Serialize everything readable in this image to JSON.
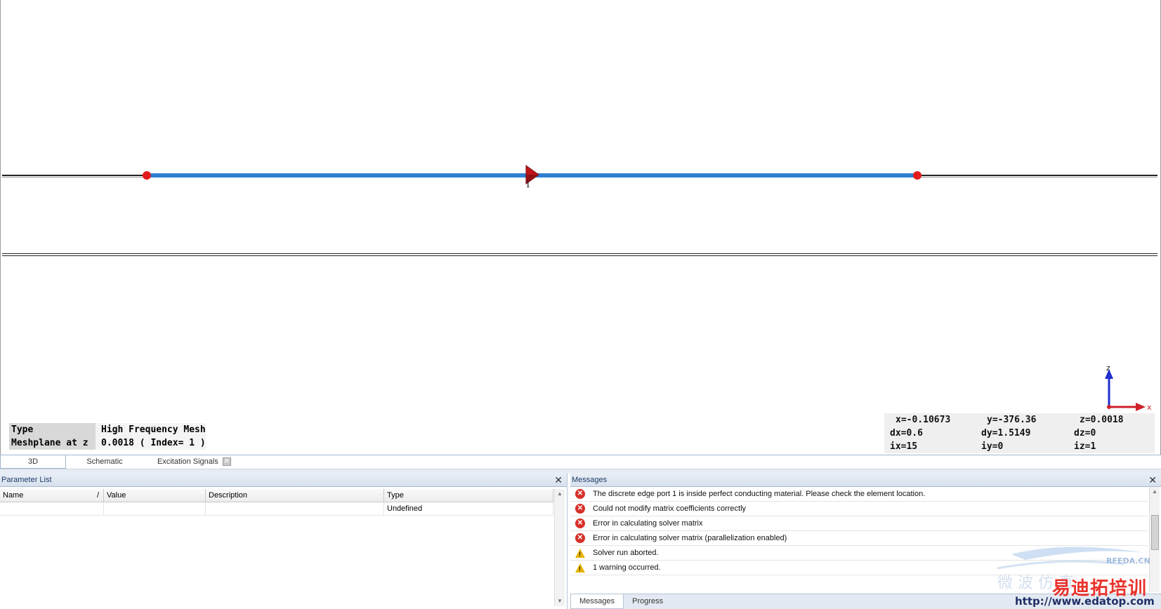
{
  "viewport": {
    "port_label": "1",
    "mesh_info": {
      "rows": [
        {
          "key": "Type",
          "value": "High Frequency Mesh"
        },
        {
          "key": "Meshplane at z",
          "value": "0.0018 ( Index= 1 )"
        }
      ]
    },
    "coords": {
      "x": "x=-0.10673",
      "y": "y=-376.36",
      "z": "z=0.0018",
      "dx": "dx=0.6",
      "dy": "dy=1.5149",
      "dz": "dz=0",
      "ix": "ix=15",
      "iy": "iy=0",
      "iz": "iz=1"
    },
    "axes": {
      "z_label": "z",
      "x_label": "x"
    }
  },
  "view_tabs": [
    {
      "label": "3D"
    },
    {
      "label": "Schematic"
    },
    {
      "label": "Excitation Signals"
    }
  ],
  "parameter_list": {
    "title": "Parameter List",
    "columns": [
      "Name",
      "Value",
      "Description",
      "Type"
    ],
    "sort_indicator": "/",
    "rows": [
      {
        "name": "",
        "value": "",
        "description": "",
        "type": "Undefined"
      }
    ]
  },
  "messages": {
    "title": "Messages",
    "items": [
      {
        "level": "error",
        "text": "The discrete edge port 1 is inside perfect conducting material. Please check the element location."
      },
      {
        "level": "error",
        "text": "Could not modify matrix coefficients correctly"
      },
      {
        "level": "error",
        "text": "Error in calculating solver matrix"
      },
      {
        "level": "error",
        "text": "Error in calculating solver matrix (parallelization enabled)"
      },
      {
        "level": "warning",
        "text": "Solver run aborted."
      },
      {
        "level": "warning",
        "text": "1 warning occurred."
      }
    ],
    "tabs": [
      {
        "label": "Messages"
      },
      {
        "label": "Progress"
      }
    ]
  },
  "watermark": {
    "brand_cn": "易迪拓培训",
    "url": "http://www.edatop.com",
    "rfeda": "RFEDA.CN"
  },
  "colors": {
    "wire": "#2e7fd2",
    "endpoint": "#e41b1b",
    "port": "#c0141a",
    "error": "#d8302a",
    "warning": "#e8b500"
  }
}
